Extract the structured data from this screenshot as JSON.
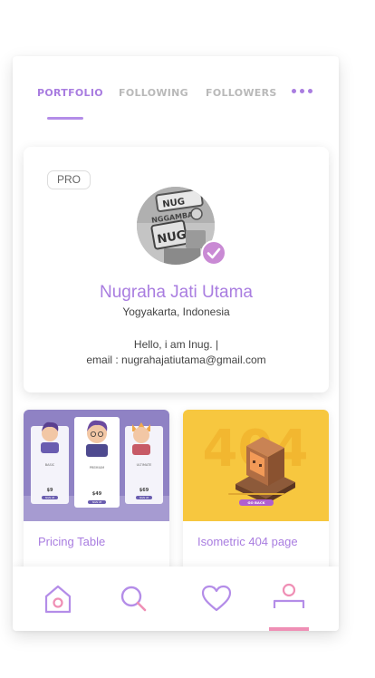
{
  "tabs": {
    "items": [
      {
        "label": "PORTFOLIO",
        "active": true
      },
      {
        "label": "FOLLOWING",
        "active": false
      },
      {
        "label": "FOLLOWERS",
        "active": false
      }
    ],
    "more_icon": "more-horizontal-icon"
  },
  "profile": {
    "badge": "PRO",
    "name": "Nugraha Jati Utama",
    "location": "Yogyakarta, Indonesia",
    "bio_line1": "Hello, i am Inug. |",
    "bio_line2": "email : nugrahajatiutama@gmail.com",
    "avatar_text_top": "NUG",
    "avatar_text_mid": "NGGAMBAR",
    "avatar_text_bot": "NUG",
    "verified_icon": "check-badge-icon"
  },
  "portfolio": [
    {
      "title": "Pricing Table",
      "plans": [
        {
          "name": "BASIC",
          "price": "$9"
        },
        {
          "name": "PREMIUM",
          "price": "$49"
        },
        {
          "name": "ULTIMATE",
          "price": "$69"
        }
      ],
      "button": "SIGN UP"
    },
    {
      "title": "Isometric 404 page",
      "headline": "404",
      "button": "GO BACK"
    }
  ],
  "bottom_nav": [
    "home-icon",
    "search-icon",
    "heart-icon",
    "profile-icon"
  ],
  "colors": {
    "accent": "#a97de0",
    "inactive": "#b9b9b9",
    "indicator": "#ef8fb5",
    "pricing_bg": "#8f82c4",
    "error_bg": "#f7c73f"
  }
}
